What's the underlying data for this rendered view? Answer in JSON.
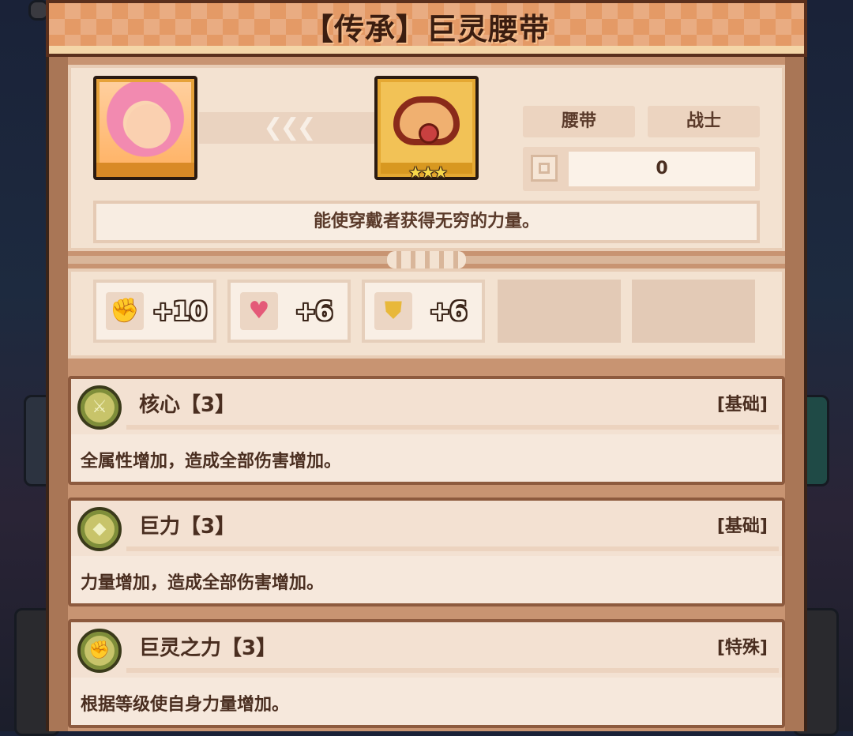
{
  "title": "【传承】巨灵腰带",
  "header": {
    "arrows": "❮❮❮",
    "stars": "★★★",
    "tags": [
      "腰带",
      "战士"
    ],
    "level_value": "0",
    "description": "能使穿戴者获得无穷的力量。"
  },
  "stats": [
    {
      "icon": "fist-icon",
      "glyph": "✊",
      "value": "+10"
    },
    {
      "icon": "heart-icon",
      "glyph": "♥",
      "value": "+6"
    },
    {
      "icon": "shield-icon",
      "glyph": "⛊",
      "value": "+6"
    }
  ],
  "skills": [
    {
      "name": "核心【3】",
      "type": "[基础]",
      "desc": "全属性增加，造成全部伤害增加。",
      "glyph": "⚔"
    },
    {
      "name": "巨力【3】",
      "type": "[基础]",
      "desc": "力量增加，造成全部伤害增加。",
      "glyph": "◆"
    },
    {
      "name": "巨灵之力【3】",
      "type": "[特殊]",
      "desc": "根据等级使自身力量增加。",
      "glyph": "✊"
    }
  ],
  "colors": {
    "panel": "#a97656",
    "title_banner": "#e49a66",
    "card": "#f3e2d1",
    "skill_icon": "#c8c46a"
  }
}
